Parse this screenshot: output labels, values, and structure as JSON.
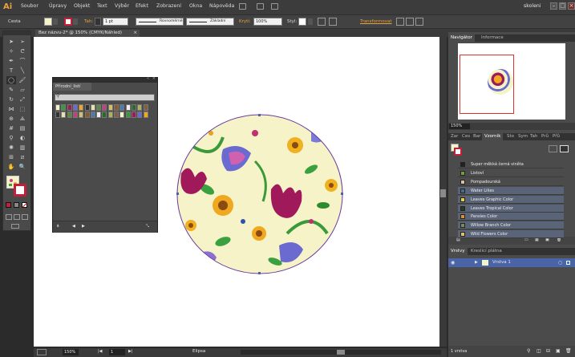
{
  "app": {
    "logo": "Ai"
  },
  "menubar": {
    "items": [
      "Soubor",
      "Úpravy",
      "Objekt",
      "Text",
      "Výběr",
      "Efekt",
      "Zobrazení",
      "Okna",
      "Nápověda"
    ],
    "workspace": "skoleni"
  },
  "controlbar": {
    "object_type": "Cesta",
    "stroke_label": "Tah:",
    "stroke_weight": "1 pt",
    "profile": "Rovnoměrně",
    "brush": "Základní",
    "opacity_label": "Krytí:",
    "opacity_value": "100%",
    "style_label": "Styl:",
    "transform_label": "Transformovat"
  },
  "document": {
    "tab_title": "Bez názvu-2* @ 150% (CMYK/Náhled)"
  },
  "library_panel": {
    "title": "Přírodní_listí"
  },
  "navigator": {
    "tabs": [
      "Navigátor",
      "Informace"
    ],
    "zoom": "150%"
  },
  "swatches": {
    "tabs": [
      "Zar",
      "Ces",
      "Bar",
      "Vzorník",
      "Sto",
      "Sym",
      "Tah",
      "Prů",
      "Přů"
    ],
    "items": [
      {
        "name": "Super měkká černá viněta",
        "color": "#222222"
      },
      {
        "name": "Listoví",
        "color": "#6aa040"
      },
      {
        "name": "Pompadourská",
        "color": "#d8c0a0"
      },
      {
        "name": "Water Lilies",
        "color": "#4a6a8a"
      },
      {
        "name": "Leaves Graphic Color",
        "color": "#e8d040"
      },
      {
        "name": "Leaves Tropical Color",
        "color": "#2a3a20"
      },
      {
        "name": "Pansies Color",
        "color": "#d89030"
      },
      {
        "name": "Willow Branch Color",
        "color": "#7a8a5a"
      },
      {
        "name": "Wild Flowers Color",
        "color": "#e0c060"
      }
    ]
  },
  "layers": {
    "tabs": [
      "Vrstvy",
      "Kreslicí plátna"
    ],
    "layer_name": "Vrstva 1",
    "count": "1 vrstva"
  },
  "status": {
    "zoom": "150%",
    "page": "1",
    "tool": "Elipsa"
  },
  "colors": {
    "accent": "#e8a33c",
    "selection": "#4a64a8",
    "artboard": "#ffffff",
    "pattern_bg": "#f7f3c8"
  }
}
